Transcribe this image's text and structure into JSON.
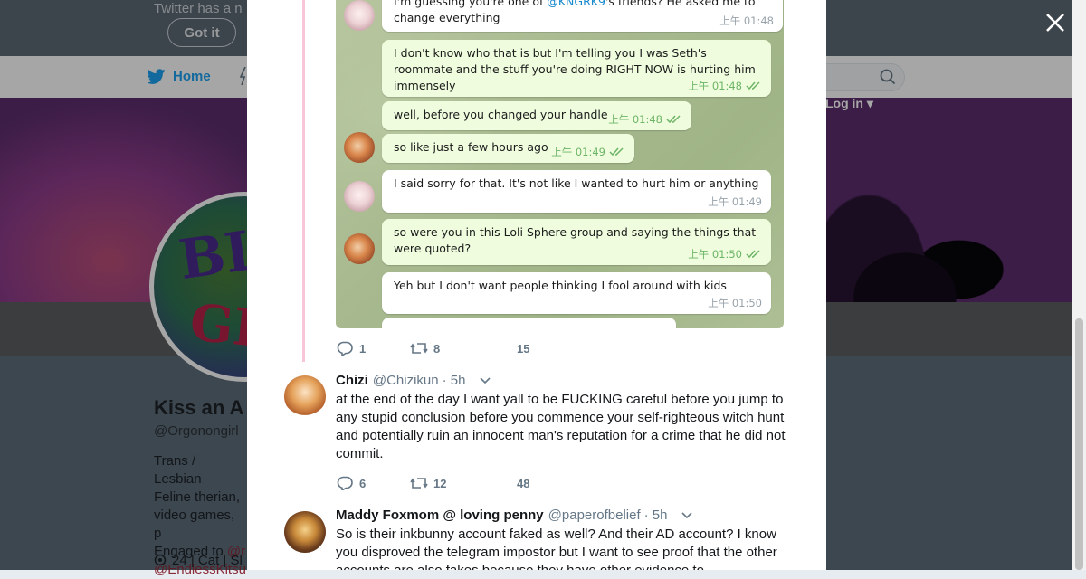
{
  "background": {
    "notice_text": "Twitter has a n",
    "got_it_label": "Got it",
    "nav_home_label": "Home",
    "login_label": "Log in",
    "profile_name": "Kiss an A",
    "profile_handle": "@Orgonongirl",
    "bio_lines": [
      "Trans / Lesbian",
      "Feline therian,",
      "video games, p",
      "Engaged to "
    ],
    "bio_link_1": "@r",
    "bio_link_2": "@EndlessKitsu",
    "location_text": "24 | Cat | Sl"
  },
  "telegram": {
    "messages": [
      {
        "text_before": "I'm guessing you're one of ",
        "mention": "@KNGRK9",
        "text_after": "'s friends? He asked me to change everything",
        "time": "上午 01:48"
      },
      {
        "text": "I don't know who that is but I'm telling you I was Seth's roommate and the stuff you're doing RIGHT NOW is hurting him immensely",
        "time": "上午 01:48"
      },
      {
        "text": "well, before you changed your handle",
        "time": "上午 01:48"
      },
      {
        "text": "so like just a few hours ago",
        "time": "上午 01:49"
      },
      {
        "text": "I said sorry for that. It's not like I wanted to hurt him or anything",
        "time": "上午 01:49"
      },
      {
        "text": "so were you in this Loli Sphere group and saying the things that were quoted?",
        "time": "上午 01:50"
      },
      {
        "text": "Yeh but I don't want people thinking I fool around with kids",
        "time": "上午 01:50"
      }
    ]
  },
  "tweets": [
    {
      "replies": "1",
      "retweets": "8",
      "likes": "15"
    },
    {
      "name": "Chizi",
      "handle": "@Chizikun",
      "time": "· 5h",
      "text": "at the end of the day I want yall to be FUCKING careful before you jump to any stupid conclusion before you commence your self-righteous witch hunt and potentially ruin an innocent man's reputation for a crime that he did not commit.",
      "replies": "6",
      "retweets": "12",
      "likes": "48"
    },
    {
      "name": "Maddy Foxmom @ loving penny",
      "handle": "@paperofbelief",
      "time": "· 5h",
      "text": "So is their inkbunny account faked as well? And their AD account? I know you disproved the telegram impostor but I want to see proof that the other accounts are also fakes because they have other evidence to"
    }
  ],
  "colors": {
    "twitter_blue": "#1da1f2",
    "telegram_out": "#effdde",
    "thread_line": "#f7c6d9",
    "check_green": "#6db566"
  }
}
